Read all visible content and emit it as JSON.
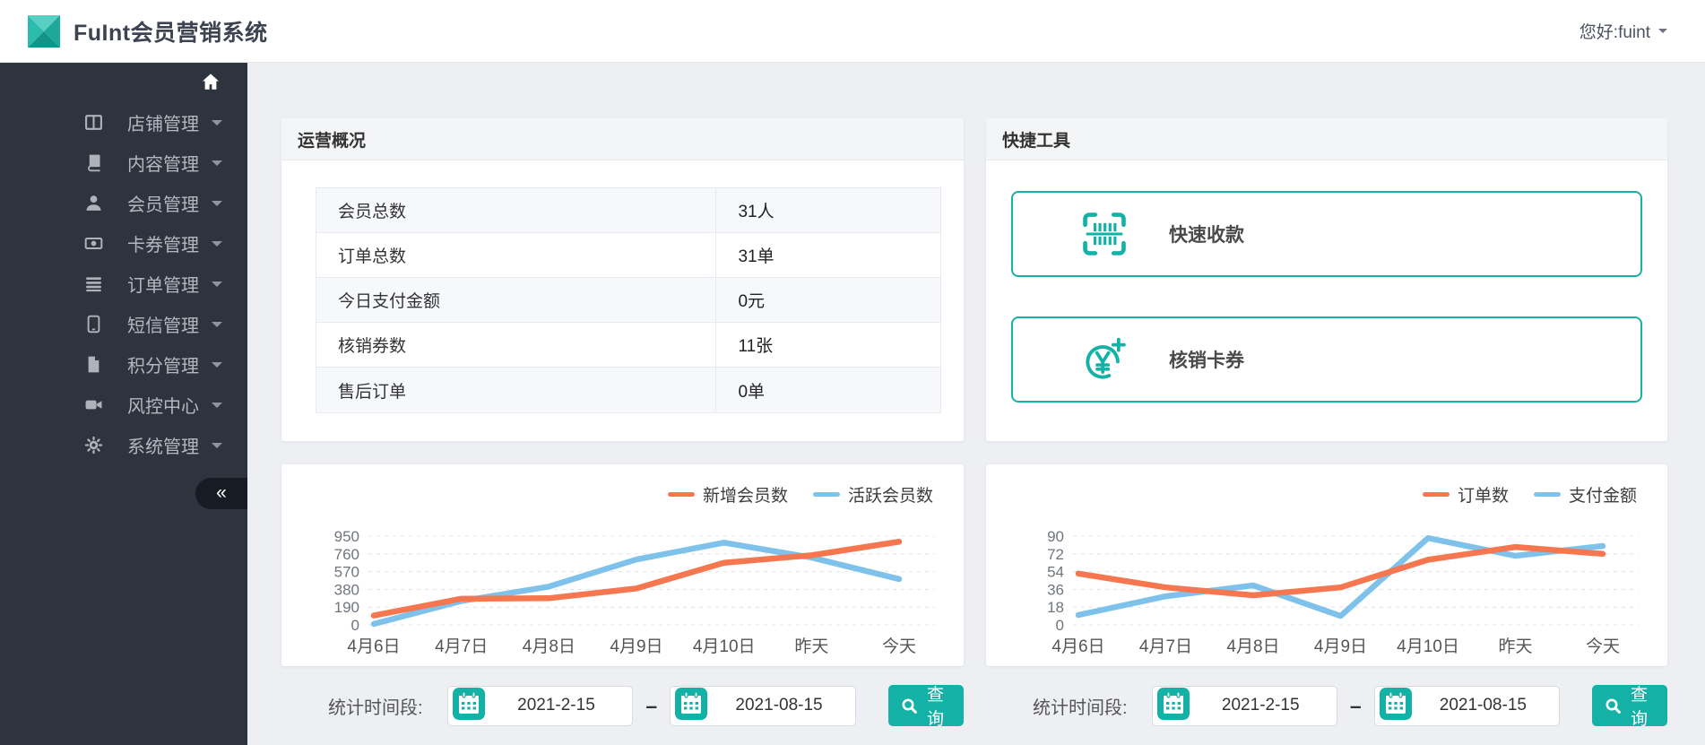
{
  "header": {
    "title": "FuInt会员营销系统",
    "greeting": "您好:fuint"
  },
  "sidebar": {
    "items": [
      {
        "label": "店铺管理",
        "icon": "store-columns-icon"
      },
      {
        "label": "内容管理",
        "icon": "book-icon"
      },
      {
        "label": "会员管理",
        "icon": "user-icon"
      },
      {
        "label": "卡券管理",
        "icon": "money-bill-icon"
      },
      {
        "label": "订单管理",
        "icon": "list-icon"
      },
      {
        "label": "短信管理",
        "icon": "mobile-icon"
      },
      {
        "label": "积分管理",
        "icon": "file-icon"
      },
      {
        "label": "风控中心",
        "icon": "video-camera-icon"
      },
      {
        "label": "系统管理",
        "icon": "gear-icon"
      }
    ],
    "collapse_glyph": "«"
  },
  "overview": {
    "title": "运营概况",
    "rows": [
      {
        "label": "会员总数",
        "value": "31人"
      },
      {
        "label": "订单总数",
        "value": "31单"
      },
      {
        "label": "今日支付金额",
        "value": "0元"
      },
      {
        "label": "核销券数",
        "value": "11张"
      },
      {
        "label": "售后订单",
        "value": "0单"
      }
    ]
  },
  "tools": {
    "title": "快捷工具",
    "items": [
      {
        "label": "快速收款",
        "icon": "scan-barcode-icon"
      },
      {
        "label": "核销卡券",
        "icon": "yen-circle-plus-icon"
      }
    ]
  },
  "filters": [
    {
      "label": "统计时间段:",
      "start": "2021-2-15",
      "end": "2021-08-15",
      "button": "查询"
    },
    {
      "label": "统计时间段:",
      "start": "2021-2-15",
      "end": "2021-08-15",
      "button": "查询"
    }
  ],
  "chart_data": [
    {
      "type": "line",
      "categories": [
        "4月6日",
        "4月7日",
        "4月8日",
        "4月9日",
        "4月10日",
        "昨天",
        "今天"
      ],
      "series": [
        {
          "name": "新增会员数",
          "color": "#f5764f",
          "values": [
            100,
            280,
            285,
            390,
            665,
            745,
            890
          ]
        },
        {
          "name": "活跃会员数",
          "color": "#7ec2ec",
          "values": [
            10,
            255,
            410,
            700,
            880,
            720,
            490
          ]
        }
      ],
      "ylim": [
        0,
        950
      ],
      "yticks": [
        0,
        190,
        380,
        570,
        760,
        950
      ],
      "grid": "dashed-horizontal",
      "legend_position": "top-right"
    },
    {
      "type": "line",
      "categories": [
        "4月6日",
        "4月7日",
        "4月8日",
        "4月9日",
        "4月10日",
        "昨天",
        "今天"
      ],
      "series": [
        {
          "name": "订单数",
          "color": "#f5764f",
          "values": [
            52,
            38,
            30,
            38,
            66,
            79,
            72
          ]
        },
        {
          "name": "支付金额",
          "color": "#7ec2ec",
          "values": [
            10,
            29,
            40,
            9,
            88,
            70,
            80
          ]
        }
      ],
      "ylim": [
        0,
        90
      ],
      "yticks": [
        0,
        18,
        36,
        54,
        72,
        90
      ],
      "grid": "dashed-horizontal",
      "legend_position": "top-right"
    }
  ],
  "colors": {
    "accent_teal": "#14b2a6",
    "series_orange": "#f5764f",
    "series_blue": "#7ec2ec",
    "sidebar_bg": "#2e343e",
    "page_bg": "#edeff2"
  }
}
